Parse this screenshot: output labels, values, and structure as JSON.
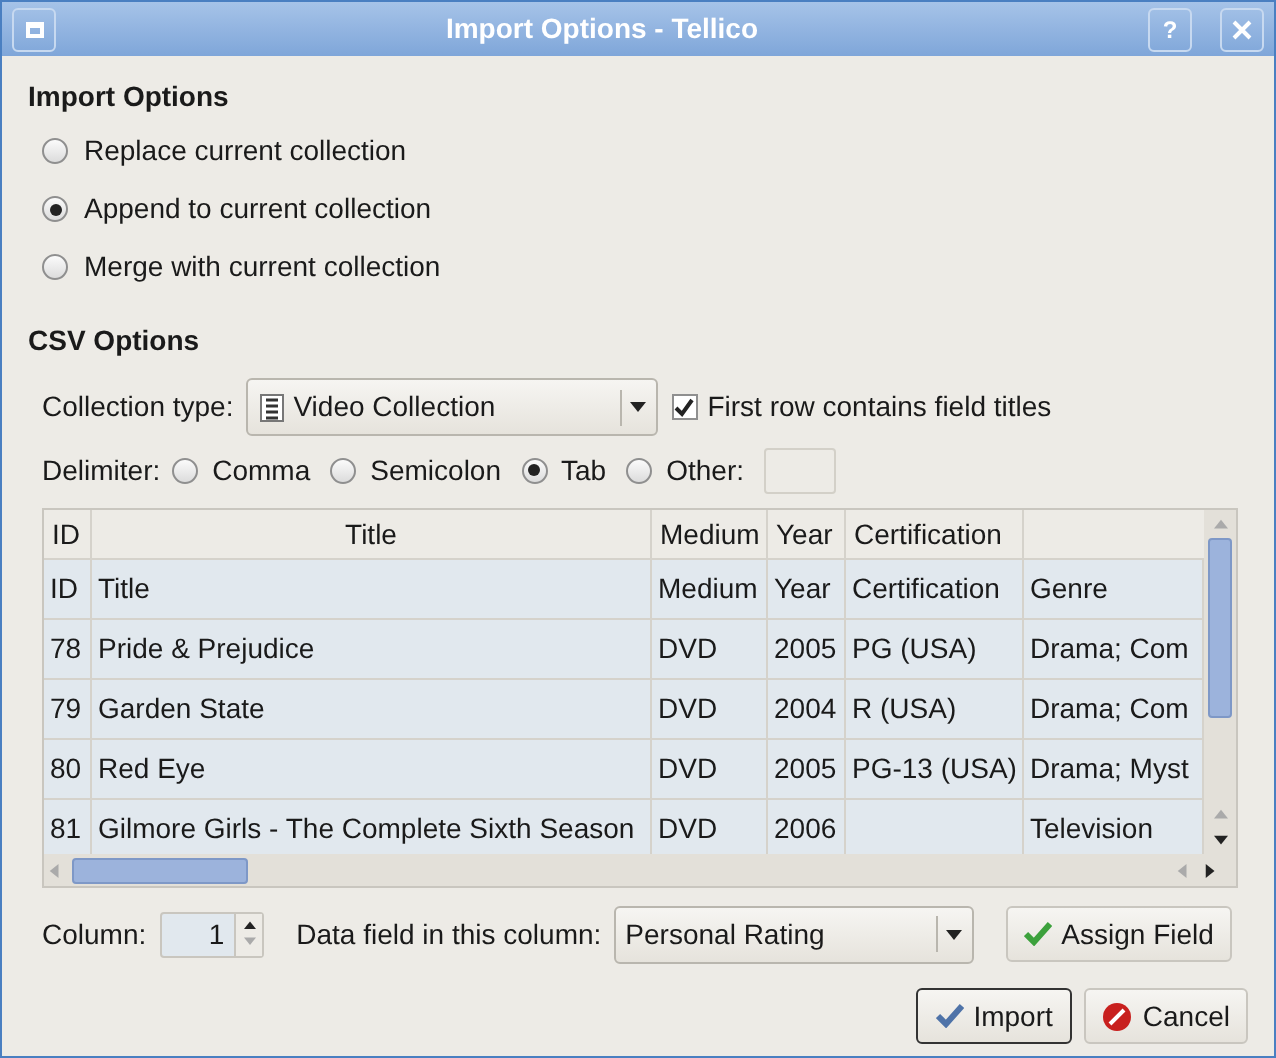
{
  "window": {
    "title": "Import Options - Tellico",
    "help": "?"
  },
  "import_options": {
    "heading": "Import Options",
    "options": [
      {
        "label": "Replace current collection",
        "selected": false
      },
      {
        "label": "Append to current collection",
        "selected": true
      },
      {
        "label": "Merge with current collection",
        "selected": false
      }
    ]
  },
  "csv_options": {
    "heading": "CSV Options",
    "collection_type_label": "Collection type:",
    "collection_type": "Video Collection",
    "first_row": {
      "label": "First row contains field titles",
      "checked": true
    },
    "delimiter_label": "Delimiter:",
    "delimiters": [
      {
        "label": "Comma",
        "selected": false
      },
      {
        "label": "Semicolon",
        "selected": false
      },
      {
        "label": "Tab",
        "selected": true
      },
      {
        "label": "Other:",
        "selected": false
      }
    ]
  },
  "table": {
    "columns": [
      "ID",
      "Title",
      "Medium",
      "Year",
      "Certification"
    ],
    "rows": [
      [
        "ID",
        "Title",
        "Medium",
        "Year",
        "Certification",
        "Genre"
      ],
      [
        "78",
        "Pride & Prejudice",
        "DVD",
        "2005",
        "PG (USA)",
        "Drama; Com"
      ],
      [
        "79",
        "Garden State",
        "DVD",
        "2004",
        "R (USA)",
        "Drama; Com"
      ],
      [
        "80",
        "Red Eye",
        "DVD",
        "2005",
        "PG-13 (USA)",
        "Drama; Myst"
      ],
      [
        "81",
        "Gilmore Girls - The Complete Sixth Season",
        "DVD",
        "2006",
        null,
        "Television"
      ]
    ]
  },
  "column_label": "Column:",
  "column_value": "1",
  "data_field_label": "Data field in this column:",
  "data_field": "Personal Rating",
  "buttons": {
    "assign": "Assign Field",
    "import": "Import",
    "cancel": "Cancel"
  }
}
